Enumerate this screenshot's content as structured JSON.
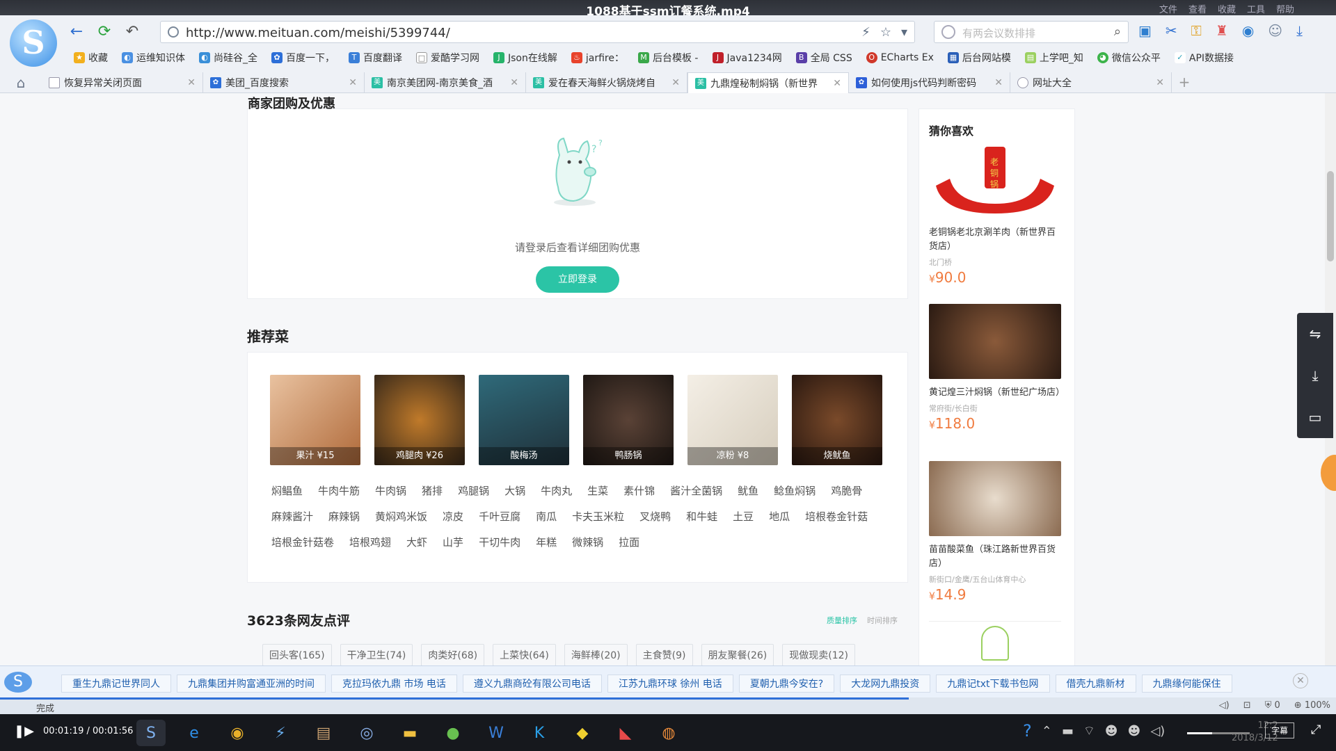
{
  "video": {
    "title": "1088基于ssm订餐系统.mp4",
    "menus": [
      "文件",
      "查看",
      "收藏",
      "工具",
      "帮助"
    ],
    "time": "00:01:19 / 00:01:56",
    "progress": 0.68
  },
  "browser": {
    "url": "http://www.meituan.com/meishi/5399744/",
    "search_placeholder": "有两会议数排排",
    "bookmarks": [
      "收藏",
      "运维知识体",
      "尚硅谷_全",
      "百度一下，",
      "百度翻译",
      "爱酷学习网",
      "Json在线解",
      "jarfire：",
      "后台模板 -",
      "Java1234网",
      "全局 CSS",
      "ECharts Ex",
      "后台网站模",
      "上学吧_知",
      "微信公众平",
      "API数据接"
    ],
    "tabs": [
      {
        "label": "恢复异常关闭页面",
        "active": false
      },
      {
        "label": "美团_百度搜索",
        "active": false
      },
      {
        "label": "南京美团网-南京美食_酒",
        "active": false
      },
      {
        "label": "爱在春天海鲜火锅烧烤自",
        "active": false
      },
      {
        "label": "九鼎煌秘制焖锅（新世界",
        "active": true
      },
      {
        "label": "如何使用js代码判断密码",
        "active": false
      },
      {
        "label": "网址大全",
        "active": false
      }
    ]
  },
  "deals": {
    "title": "商家团购及优惠",
    "message": "请登录后查看详细团购优惠",
    "login_label": "立即登录"
  },
  "recommend": {
    "title": "推荐菜",
    "dishes": [
      {
        "caption": "果汁 ¥15",
        "color": "#c9835a"
      },
      {
        "caption": "鸡腿肉 ¥26",
        "color": "#6a4a2a"
      },
      {
        "caption": "酸梅汤",
        "color": "#3a5a66"
      },
      {
        "caption": "鸭肠锅",
        "color": "#3e2f2a"
      },
      {
        "caption": "凉粉 ¥8",
        "color": "#e8e2d6"
      },
      {
        "caption": "烧鱿鱼",
        "color": "#4a2e22"
      }
    ],
    "tags": [
      "焖鲳鱼",
      "牛肉牛筋",
      "牛肉锅",
      "猪排",
      "鸡腿锅",
      "大锅",
      "牛肉丸",
      "生菜",
      "素什锦",
      "酱汁全菌锅",
      "鱿鱼",
      "鲶鱼焖锅",
      "鸡脆骨",
      "麻辣酱汁",
      "麻辣锅",
      "黄焖鸡米饭",
      "凉皮",
      "千叶豆腐",
      "南瓜",
      "卡夫玉米粒",
      "叉烧鸭",
      "和牛蛙",
      "土豆",
      "地瓜",
      "培根卷金针菇",
      "培根金针菇卷",
      "培根鸡翅",
      "大虾",
      "山芋",
      "干切牛肉",
      "年糕",
      "微辣锅",
      "拉面"
    ]
  },
  "reviews": {
    "title": "3623条网友点评",
    "sort": [
      "质量排序",
      "时间排序"
    ],
    "tags": [
      "回头客(165)",
      "干净卫生(74)",
      "肉类好(68)",
      "上菜快(64)",
      "海鲜棒(20)",
      "主食赞(9)",
      "朋友聚餐(26)",
      "现做现卖(12)"
    ]
  },
  "guess": {
    "title": "猜你喜欢",
    "items": [
      {
        "name": "老铜锅老北京涮羊肉（新世界百货店）",
        "sub": "北门桥",
        "price": "90.0",
        "color": "#d9231d"
      },
      {
        "name": "黄记煌三汁焖锅（新世纪广场店）",
        "sub": "常府街/长白街",
        "price": "118.0",
        "color": "#5a3a28"
      },
      {
        "name": "苗苗酸菜鱼（珠江路新世界百货店）",
        "sub": "新街口/金鹰/五台山体育中心",
        "price": "14.9",
        "color": "#c9b9a5"
      }
    ]
  },
  "news": [
    "重生九鼎记世界同人",
    "九鼎集团并购富通亚洲的时间",
    "克拉玛依九鼎 市场 电话",
    "遵义九鼎商砼有限公司电话",
    "江苏九鼎环球 徐州 电话",
    "夏朝九鼎今安在?",
    "大龙网九鼎投资",
    "九鼎记txt下载书包网",
    "借壳九鼎新材",
    "九鼎缘何能保住"
  ],
  "status": {
    "text": "完成",
    "zoom": "100%",
    "count": "0"
  },
  "taskbar": {
    "clock_time": "12:2",
    "clock_date": "2018/3/12",
    "cc_label": "字幕"
  }
}
